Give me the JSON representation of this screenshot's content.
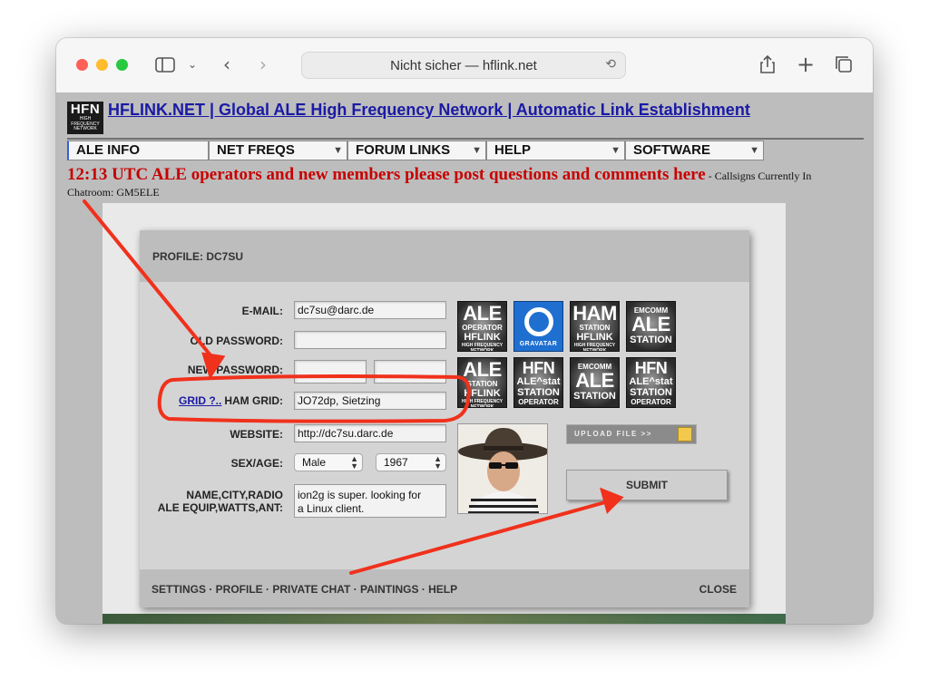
{
  "browser": {
    "address": "Nicht sicher — hflink.net"
  },
  "site": {
    "logo": {
      "big": "HFN",
      "small1": "HIGH",
      "small2": "FREQUENCY",
      "small3": "NETWORK"
    },
    "title": "HFLINK.NET | Global ALE High Frequency Network | Automatic Link Establishment"
  },
  "menu": [
    {
      "label": "ALE INFO"
    },
    {
      "label": "NET FREQS"
    },
    {
      "label": "FORUM LINKS"
    },
    {
      "label": "HELP"
    },
    {
      "label": "SOFTWARE"
    }
  ],
  "marquee": {
    "main": "12:13 UTC ALE operators and new members please post questions and comments here",
    "suffix": " - Callsigns Currently In",
    "line2": "Chatroom: GM5ELE"
  },
  "profile": {
    "title": "PROFILE: DC7SU",
    "email_label": "E-MAIL:",
    "email_value": "dc7su@darc.de",
    "old_password_label": "OLD PASSWORD:",
    "new_password_label": "NEW PASSWORD:",
    "grid_link": "GRID ?..",
    "ham_grid_label": "HAM GRID:",
    "ham_grid_value": "JO72dp, Sietzing",
    "website_label": "WEBSITE:",
    "website_value": "http://dc7su.darc.de",
    "sexage_label": "SEX/AGE:",
    "sex_value": "Male",
    "age_value": "1967",
    "name_label_1": "NAME,CITY,RADIO",
    "name_label_2": "ALE EQUIP,WATTS,ANT:",
    "name_value_1": "ion2g is super. looking for",
    "name_value_2": "a Linux client.",
    "upload_label": "UPLOAD FILE  >>",
    "submit_label": "SUBMIT"
  },
  "badges": {
    "b1": {
      "top": "",
      "big": "ALE",
      "mid": "OPERATOR",
      "line3": "HFLINK",
      "small": "HIGH FREQUENCY NETWORK"
    },
    "gravatar": "GRAVATAR",
    "b3": {
      "big": "HAM",
      "mid": "STATION",
      "line3": "HFLINK",
      "small": "HIGH FREQUENCY NETWORK"
    },
    "b4": {
      "top": "EMCOMM",
      "big": "ALE",
      "line3": "STATION"
    },
    "b5": {
      "big": "ALE",
      "mid": "STATION",
      "line3": "HFLINK",
      "small": "HIGH FREQUENCY NETWORK"
    },
    "b6": {
      "big": "HFN",
      "mid": "ALE^stat",
      "line3": "STATION",
      "line4": "OPERATOR"
    },
    "b7": {
      "top": "EMCOMM",
      "big": "ALE",
      "line3": "STATION"
    },
    "b8": {
      "big": "HFN",
      "mid": "ALE^stat",
      "line3": "STATION",
      "line4": "OPERATOR"
    }
  },
  "footer": {
    "links": "SETTINGS · PROFILE · PRIVATE CHAT · PAINTINGS · HELP",
    "close": "CLOSE"
  },
  "colors": {
    "annotation_red": "#f0311c",
    "link_blue": "#1a1aa6",
    "marquee_red": "#c80000"
  }
}
